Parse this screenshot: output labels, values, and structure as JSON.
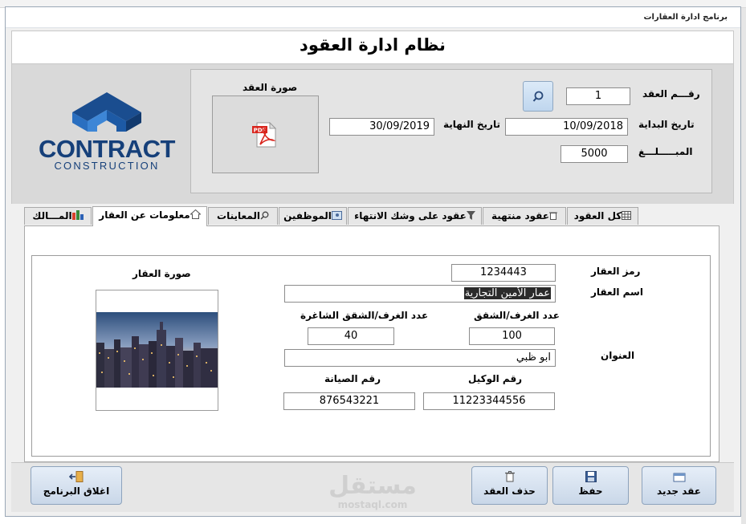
{
  "window": {
    "title": "برنامج ادارة العقارات"
  },
  "header": {
    "title": "نظام ادارة العقود"
  },
  "contract": {
    "number_label": "رقـــم العقد",
    "number": "1",
    "start_label": "تاريخ البداية",
    "start_date": "10/09/2018",
    "end_label": "تاريخ النهاية",
    "end_date": "30/09/2019",
    "amount_label": "المبـــــلـــغ",
    "amount": "5000",
    "image_label": "صورة العقد"
  },
  "logo": {
    "word": "CONTRACT",
    "sub": "CONSTRUCTION",
    "color": "#16407a"
  },
  "tabs": [
    {
      "label": "كل العقود",
      "icon": "table-icon"
    },
    {
      "label": "عقود منتهية",
      "icon": "trash-icon"
    },
    {
      "label": "عقود على وشك الانتهاء",
      "icon": "filter-icon"
    },
    {
      "label": "الموظفين",
      "icon": "staff-icon"
    },
    {
      "label": "المعاينات",
      "icon": "search-icon"
    },
    {
      "label": "معلومات عن العقار",
      "icon": "home-icon",
      "active": true
    },
    {
      "label": "المـــالك",
      "icon": "owner-icon"
    }
  ],
  "property": {
    "code_label": "رمز العقار",
    "code": "1234443",
    "name_label": "اسم العقار",
    "name": "عمار الأمين التجارية",
    "rooms_label": "عدد الغرف/الشقق",
    "rooms": "100",
    "vacant_label": "عدد الغرف/الشقق الشاغرة",
    "vacant": "40",
    "address_label": "العنوان",
    "address": "ابو ظبي",
    "agent_label": "رقم الوكيل",
    "agent": "11223344556",
    "maintenance_label": "رقم الصيانة",
    "maintenance": "876543221",
    "image_label": "صورة العقار"
  },
  "buttons": {
    "new": "عقد جديد",
    "save": "حفظ",
    "delete": "حذف العقد",
    "close": "اغلاق البرنامج"
  },
  "watermark": {
    "text": "مستقل",
    "sub": "mostaql.com"
  }
}
